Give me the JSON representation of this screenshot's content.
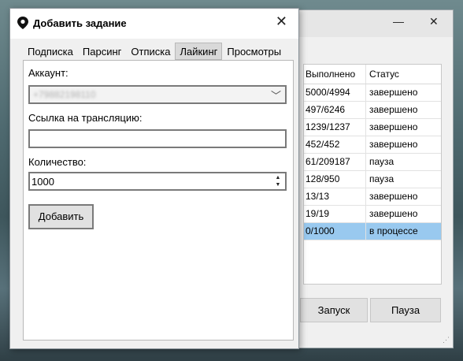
{
  "background_window": {
    "table": {
      "headers": [
        "Выполнено",
        "Статус"
      ],
      "rows": [
        [
          "5000/4994",
          "завершено"
        ],
        [
          "497/6246",
          "завершено"
        ],
        [
          "1239/1237",
          "завершено"
        ],
        [
          "452/452",
          "завершено"
        ],
        [
          "61/209187",
          "пауза"
        ],
        [
          "128/950",
          "пауза"
        ],
        [
          "13/13",
          "завершено"
        ],
        [
          "19/19",
          "завершено"
        ],
        [
          "0/1000",
          "в процессе"
        ]
      ],
      "selected_row": 8,
      "selected_color": "#99c9ef"
    },
    "start_label": "Запуск",
    "pause_label": "Пауза",
    "minimize_glyph": "—",
    "close_glyph": "✕"
  },
  "dialog": {
    "title": "Добавить задание",
    "close_glyph": "✕",
    "tabs": [
      {
        "label": "Подписка",
        "active": false
      },
      {
        "label": "Парсинг",
        "active": false
      },
      {
        "label": "Отписка",
        "active": false
      },
      {
        "label": "Лайкинг",
        "active": true
      },
      {
        "label": "Просмотры",
        "active": false
      }
    ],
    "account_label": "Аккаунт:",
    "account_value": "+79882198110",
    "link_label": "Ссылка на трансляцию:",
    "link_value": "",
    "quantity_label": "Количество:",
    "quantity_value": "1000",
    "add_label": "Добавить"
  }
}
